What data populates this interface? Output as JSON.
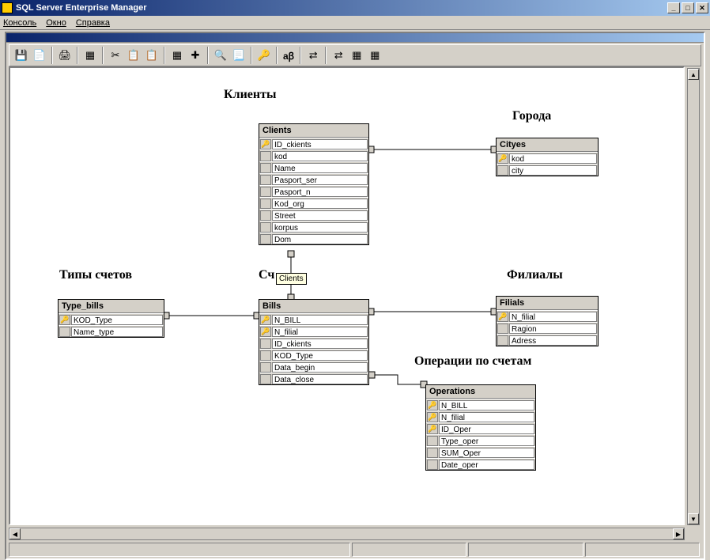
{
  "window": {
    "title": "SQL Server Enterprise Manager"
  },
  "menu": {
    "console": "Консоль",
    "window": "Окно",
    "help": "Справка"
  },
  "toolbar": {
    "save": "💾",
    "script": "📄",
    "print": "🖨",
    "toggle": "▦",
    "cut": "✂",
    "copy": "📋",
    "paste": "📋",
    "newtable": "▦",
    "add": "✚",
    "zoom": "🔍",
    "props": "📃",
    "key": "🔑",
    "ab": "aꞵ",
    "rel1": "⇄",
    "rel2": "⇄",
    "grid1": "▦",
    "grid2": "▦"
  },
  "labels": {
    "clients": "Клиенты",
    "cities": "Города",
    "billtypes": "Типы счетов",
    "accounts": "Сч",
    "branches": "Филиалы",
    "operations": "Операции по счетам"
  },
  "tooltip": "Clients",
  "tables": {
    "clients": {
      "name": "Clients",
      "fields": [
        {
          "n": "ID_ckients",
          "k": true
        },
        {
          "n": "kod",
          "k": false
        },
        {
          "n": "Name",
          "k": false
        },
        {
          "n": "Pasport_ser",
          "k": false
        },
        {
          "n": "Pasport_n",
          "k": false
        },
        {
          "n": "Kod_org",
          "k": false
        },
        {
          "n": "Street",
          "k": false
        },
        {
          "n": "korpus",
          "k": false
        },
        {
          "n": "Dom",
          "k": false
        }
      ]
    },
    "cityes": {
      "name": "Cityes",
      "fields": [
        {
          "n": "kod",
          "k": true
        },
        {
          "n": "city",
          "k": false
        }
      ]
    },
    "typebills": {
      "name": "Type_bills",
      "fields": [
        {
          "n": "KOD_Type",
          "k": true
        },
        {
          "n": "Name_type",
          "k": false
        }
      ]
    },
    "bills": {
      "name": "Bills",
      "fields": [
        {
          "n": "N_BILL",
          "k": true
        },
        {
          "n": "N_filial",
          "k": true
        },
        {
          "n": "ID_ckients",
          "k": false
        },
        {
          "n": "KOD_Type",
          "k": false
        },
        {
          "n": "Data_begin",
          "k": false
        },
        {
          "n": "Data_close",
          "k": false
        }
      ]
    },
    "filials": {
      "name": "Filials",
      "fields": [
        {
          "n": "N_filial",
          "k": true
        },
        {
          "n": "Ragion",
          "k": false
        },
        {
          "n": "Adress",
          "k": false
        }
      ]
    },
    "operations": {
      "name": "Operations",
      "fields": [
        {
          "n": "N_BILL",
          "k": true
        },
        {
          "n": "N_filial",
          "k": true
        },
        {
          "n": "ID_Oper",
          "k": true
        },
        {
          "n": "Type_oper",
          "k": false
        },
        {
          "n": "SUM_Oper",
          "k": false
        },
        {
          "n": "Date_oper",
          "k": false
        }
      ]
    }
  }
}
